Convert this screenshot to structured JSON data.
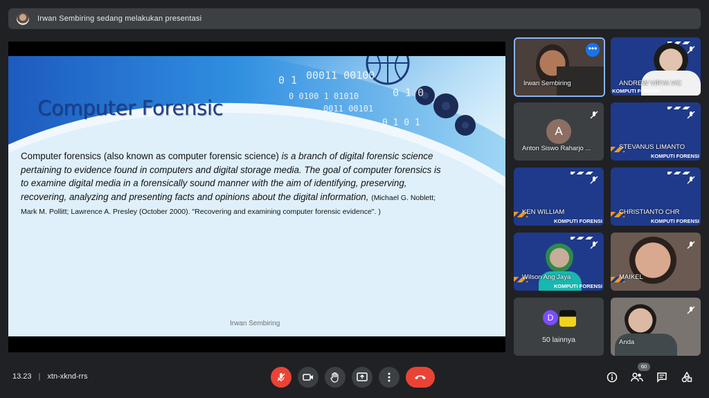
{
  "banner": {
    "text": "Irwan Sembiring sedang melakukan presentasi"
  },
  "slide": {
    "title": "Computer Forensic",
    "art_digits": [
      "0 1",
      "00011 00100",
      "0 1 0",
      "0 0100 1 01010",
      "0011 00101",
      "0 1 0 1"
    ],
    "body_plain": "Computer forensics (also known as computer forensic science) ",
    "body_italic": "is a branch of digital forensic science pertaining to evidence found in computers and digital storage media. The goal of computer forensics is to examine digital media in a forensically sound manner with the aim of identifying, preserving, recovering, analyzing and presenting facts and opinions about the digital information,",
    "citation": "(Michael G. Noblett; Mark M. Pollitt; Lawrence A. Presley (October 2000). \"Recovering and examining computer forensic evidence\". )",
    "footer": "Irwan Sembiring"
  },
  "participants": [
    {
      "name": "Irwan Sembiring"
    },
    {
      "name": "ANDREW VIRYA VIC",
      "brand": "KOMPUTI FORENSI"
    },
    {
      "name": "Anton Siswo Raharjo ...",
      "initial": "A"
    },
    {
      "name": "STEVANUS LIMANTO",
      "brand": "KOMPUTI FORENSI"
    },
    {
      "name": "KEN WILLIAM",
      "brand": "KOMPUTI FORENSI"
    },
    {
      "name": "CHRISTIANTO CHR",
      "brand": "KOMPUTI FORENSI"
    },
    {
      "name": "Wilson Ang Jaya",
      "brand": "KOMPUTI FORENSI"
    },
    {
      "name": "MAIKEL"
    },
    {
      "name": "Anda"
    }
  ],
  "others": {
    "initial": "D",
    "label": "50 lainnya"
  },
  "bottom": {
    "time": "13.23",
    "separator": "|",
    "meeting_code": "xtn-xknd-rrs",
    "people_count": "60"
  },
  "colors": {
    "accent": "#1a73e8",
    "danger": "#ea4335",
    "surface": "#3c4043",
    "background": "#202124"
  }
}
